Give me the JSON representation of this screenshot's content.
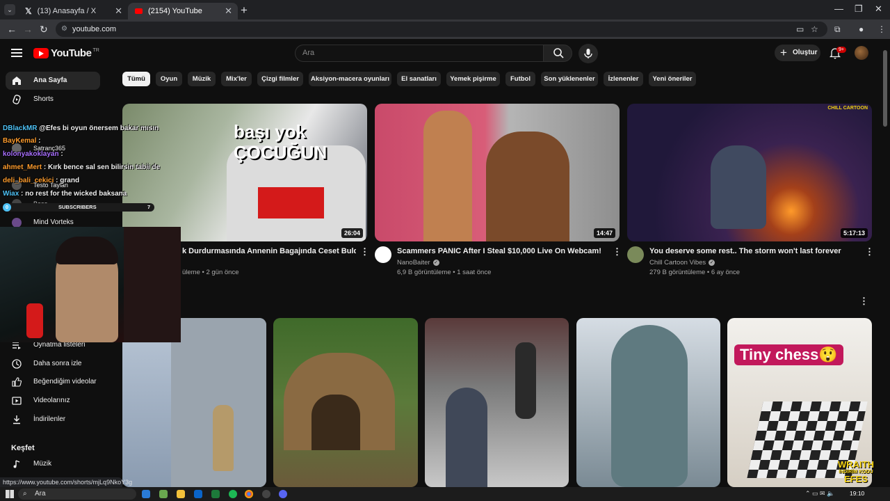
{
  "browser": {
    "tabs": [
      {
        "title": "(13) Anasayfa / X"
      },
      {
        "title": "(2154) YouTube"
      }
    ],
    "url": "youtube.com"
  },
  "youtube": {
    "logo_text": "YouTube",
    "logo_region": "TR",
    "search_placeholder": "Ara",
    "create_label": "Oluştur",
    "notification_count": "9+"
  },
  "sidebar": {
    "items_top": [
      {
        "label": "Ana Sayfa",
        "icon": "home-icon",
        "active": true
      },
      {
        "label": "Shorts",
        "icon": "shorts-icon",
        "active": false
      }
    ],
    "subscriptions": [
      {
        "label": "Satranç365"
      },
      {
        "label": "Testo Taylan"
      },
      {
        "label": "Baso"
      },
      {
        "label": "Mind Vorteks"
      }
    ],
    "items_you": [
      {
        "label": "Oynatma listeleri",
        "icon": "playlist-icon"
      },
      {
        "label": "Daha sonra izle",
        "icon": "clock-icon"
      },
      {
        "label": "Beğendiğim videolar",
        "icon": "thumbs-up-icon"
      },
      {
        "label": "Videolarınız",
        "icon": "video-icon"
      },
      {
        "label": "İndirilenler",
        "icon": "download-icon"
      }
    ],
    "explore_heading": "Keşfet",
    "explore_items": [
      {
        "label": "Müzik",
        "icon": "music-icon"
      }
    ]
  },
  "chips": [
    "Tümü",
    "Oyun",
    "Müzik",
    "Mix'ler",
    "Çizgi filmler",
    "Aksiyon-macera oyunları",
    "El sanatları",
    "Yemek pişirme",
    "Futbol",
    "Son yüklenenler",
    "İzlenenler",
    "Yeni öneriler"
  ],
  "videos": [
    {
      "title": "k Durdurmasında Annenin Bagajında Ceset Buldu",
      "channel": "",
      "meta": "üleme • 2 gün önce",
      "duration": "26:04",
      "overlay_text": "başı yok\nÇOCUĞUN"
    },
    {
      "title": "Scammers PANIC After I Steal $10,000 Live On Webcam!",
      "channel": "NanoBaiter",
      "meta": "6,9 B görüntüleme • 1 saat önce",
      "duration": "14:47"
    },
    {
      "title": "You deserve some rest.. The storm won't last forever",
      "channel": "Chill Cartoon Vibes",
      "meta": "279 B görüntüleme • 6 ay önce",
      "duration": "5:17:13",
      "corner_text": "CHILL CARTOON"
    }
  ],
  "shorts_overlay_text": "Tiny chess😲",
  "stream_overlay": {
    "chat": [
      {
        "user": "DBlackMR",
        "text": "@Efes bi oyun önersem bakar mısın",
        "color": "#ffffff"
      },
      {
        "user": "BayKemal",
        "text": ":",
        "color": "#ff9d2e"
      },
      {
        "user": "kolonyakoklayan",
        "text": ":",
        "color": "#a970ff"
      },
      {
        "user": "ahmet_Mert",
        "text": ": Kırk bence sal sen bilirsin tabii de",
        "color": "#ff9d2e"
      },
      {
        "user": "deli_bali_cekici",
        "text": ": grand",
        "color": "#ff9d2e"
      },
      {
        "user": "Wiax",
        "text": ": no rest for the wicked baksana",
        "color": "#4fc3f7"
      }
    ],
    "subs_label": "SUBSCRIBERS",
    "subs_start": "0",
    "subs_goal": "7",
    "watermark_line1": "WRAITH",
    "watermark_line2": "İNDİRİM KODU",
    "watermark_line3": "EFES"
  },
  "status_url": "https://www.youtube.com/shorts/mjLq9NkoY3g",
  "taskbar": {
    "search_text": "Ara",
    "time": "19:10"
  },
  "colors": {
    "yt_red": "#ff0000",
    "background": "#0f0f0f",
    "chip_bg": "#272727"
  }
}
